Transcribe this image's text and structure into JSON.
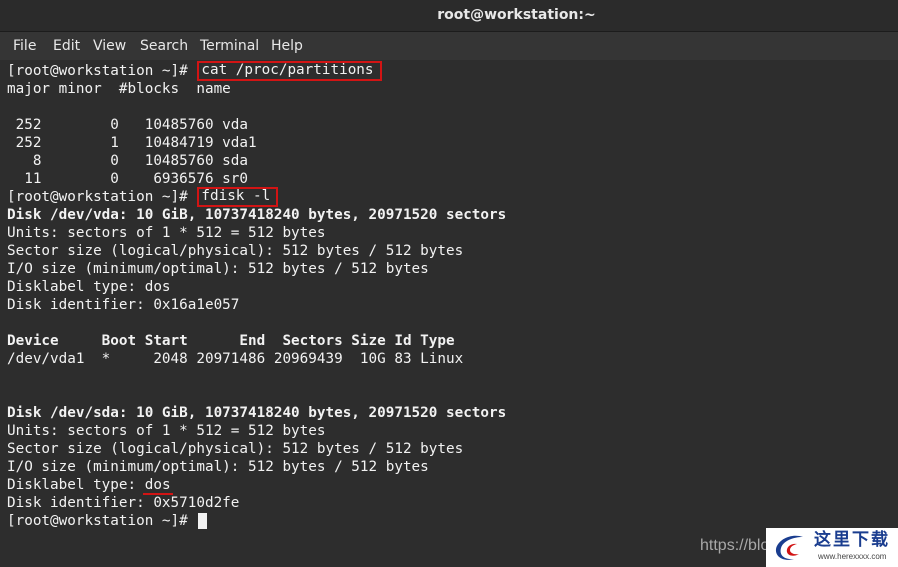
{
  "window": {
    "title": "root@workstation:~"
  },
  "menu": [
    "File",
    "Edit",
    "View",
    "Search",
    "Terminal",
    "Help"
  ],
  "terminal": {
    "prompt": "[root@workstation ~]# ",
    "commands": {
      "cat": "cat /proc/partitions",
      "fdisk": "fdisk -l"
    },
    "partitions": {
      "header": "major minor  #blocks  name",
      "rows": [
        " 252        0   10485760 vda",
        " 252        1   10484719 vda1",
        "   8        0   10485760 sda",
        "  11        0    6936576 sr0"
      ]
    },
    "vda": {
      "disk": "Disk /dev/vda: 10 GiB, 10737418240 bytes, 20971520 sectors",
      "units": "Units: sectors of 1 * 512 = 512 bytes",
      "sector_size": "Sector size (logical/physical): 512 bytes / 512 bytes",
      "io_size": "I/O size (minimum/optimal): 512 bytes / 512 bytes",
      "label_type": "Disklabel type: dos",
      "identifier": "Disk identifier: 0x16a1e057",
      "table_header": "Device     Boot Start      End  Sectors Size Id Type",
      "table_row": "/dev/vda1  *     2048 20971486 20969439  10G 83 Linux"
    },
    "sda": {
      "disk": "Disk /dev/sda: 10 GiB, 10737418240 bytes, 20971520 sectors",
      "units": "Units: sectors of 1 * 512 = 512 bytes",
      "sector_size": "Sector size (logical/physical): 512 bytes / 512 bytes",
      "io_size": "I/O size (minimum/optimal): 512 bytes / 512 bytes",
      "label_prefix": "Disklabel type: ",
      "label_value": "dos",
      "identifier": "Disk identifier: 0x5710d2fe"
    }
  },
  "watermark": {
    "url": "https://blo",
    "logo_text": "这里下载",
    "logo_url": "www.herexxxx.com"
  },
  "colors": {
    "terminal_bg": "#2d2d2d",
    "text": "#f2f2f2",
    "highlight": "#d21414"
  }
}
